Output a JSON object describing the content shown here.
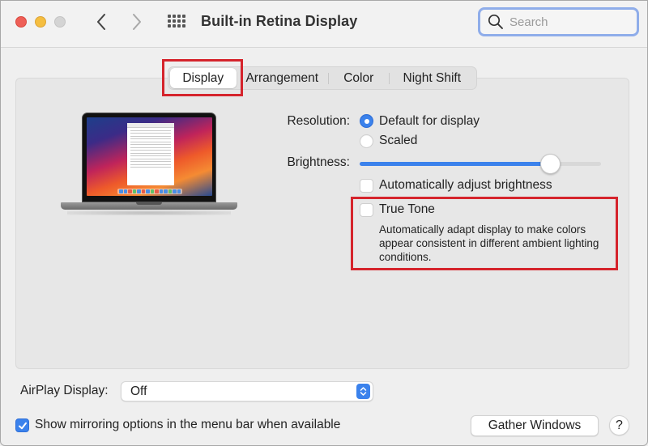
{
  "window": {
    "title": "Built-in Retina Display",
    "controls": {
      "close": "close",
      "minimize": "minimize",
      "zoom": "zoom"
    }
  },
  "toolbar": {
    "back_icon": "chevron-left-icon",
    "forward_icon": "chevron-right-icon",
    "show_all_icon": "grid-icon",
    "search": {
      "placeholder": "Search",
      "value": ""
    }
  },
  "tabs": [
    {
      "label": "Display",
      "selected": true
    },
    {
      "label": "Arrangement",
      "selected": false
    },
    {
      "label": "Color",
      "selected": false
    },
    {
      "label": "Night Shift",
      "selected": false
    }
  ],
  "display": {
    "resolution": {
      "label": "Resolution:",
      "options": [
        {
          "label": "Default for display",
          "selected": true
        },
        {
          "label": "Scaled",
          "selected": false
        }
      ]
    },
    "brightness": {
      "label": "Brightness:",
      "value_percent": 79,
      "auto_adjust": {
        "label": "Automatically adjust brightness",
        "checked": false
      }
    },
    "true_tone": {
      "label": "True Tone",
      "checked": false,
      "description": "Automatically adapt display to make colors appear consistent in different ambient lighting conditions."
    }
  },
  "airplay": {
    "label": "AirPlay Display:",
    "value": "Off"
  },
  "mirroring": {
    "label": "Show mirroring options in the menu bar when available",
    "checked": true
  },
  "buttons": {
    "gather_windows": "Gather Windows",
    "help": "?"
  },
  "colors": {
    "accent": "#3b82ec",
    "highlight_annotation": "#d5242c",
    "search_focus_ring": "#8fadea"
  }
}
